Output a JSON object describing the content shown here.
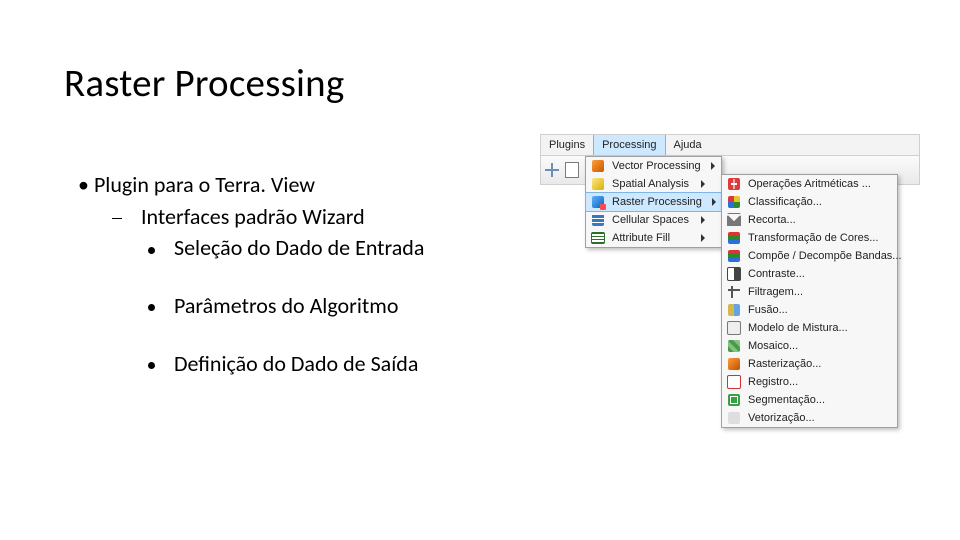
{
  "slide": {
    "title": "Raster Processing",
    "bullets": {
      "lvl1": "Plugin para o Terra. View",
      "lvl2": "Interfaces padrão Wizard",
      "lvl3a": "Seleção do Dado de Entrada",
      "lvl3b": "Parâmetros do Algoritmo",
      "lvl3c": "Definição do Dado de Saída"
    }
  },
  "screenshot": {
    "menubar": {
      "plugins": "Plugins",
      "processing": "Processing",
      "ajuda": "Ajuda"
    },
    "dropdown1": [
      {
        "label": "Vector Processing",
        "icon": "ic-vector"
      },
      {
        "label": "Spatial Analysis",
        "icon": "ic-spatial"
      },
      {
        "label": "Raster Processing",
        "icon": "ic-raster"
      },
      {
        "label": "Cellular Spaces",
        "icon": "ic-cell"
      },
      {
        "label": "Attribute Fill",
        "icon": "ic-attr"
      }
    ],
    "dropdown2": [
      {
        "label": "Operações Aritméticas ...",
        "icon": "ic-arit"
      },
      {
        "label": "Classificação...",
        "icon": "ic-class"
      },
      {
        "label": "Recorta...",
        "icon": "ic-recorta"
      },
      {
        "label": "Transformação de Cores...",
        "icon": "ic-bandas"
      },
      {
        "label": "Compõe / Decompõe Bandas...",
        "icon": "ic-bandas"
      },
      {
        "label": "Contraste...",
        "icon": "ic-contr"
      },
      {
        "label": "Filtragem...",
        "icon": "ic-filt"
      },
      {
        "label": "Fusão...",
        "icon": "ic-fusao"
      },
      {
        "label": "Modelo de Mistura...",
        "icon": "ic-mix"
      },
      {
        "label": "Mosaico...",
        "icon": "ic-mos"
      },
      {
        "label": "Rasterização...",
        "icon": "ic-rast"
      },
      {
        "label": "Registro...",
        "icon": "ic-reg"
      },
      {
        "label": "Segmentação...",
        "icon": "ic-seg"
      },
      {
        "label": "Vetorização...",
        "icon": "ic-vet"
      }
    ]
  }
}
